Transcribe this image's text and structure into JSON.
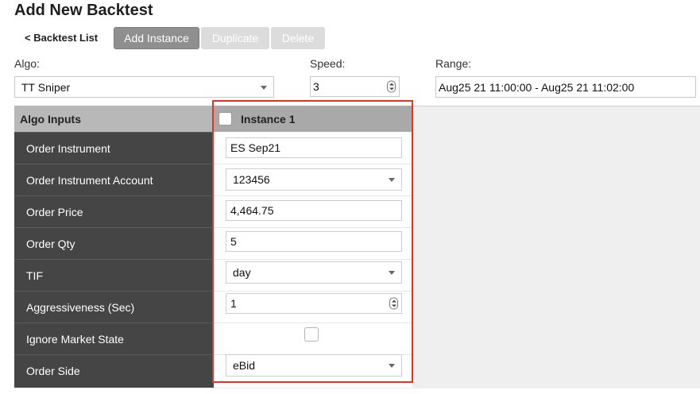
{
  "page": {
    "title": "Add New Backtest"
  },
  "toolbar": {
    "back_label": "< Backtest List",
    "add_instance_label": "Add Instance",
    "duplicate_label": "Duplicate",
    "delete_label": "Delete"
  },
  "settings": {
    "algo_label": "Algo:",
    "algo_value": "TT Sniper",
    "speed_label": "Speed:",
    "speed_value": "3",
    "range_label": "Range:",
    "range_value": "Aug25 21 11:00:00 - Aug25 21 11:02:00"
  },
  "grid": {
    "header_left": "Algo Inputs",
    "instance_label": "Instance 1",
    "instance_checked": false,
    "rows": [
      {
        "label": "Order Instrument",
        "value": "ES Sep21",
        "kind": "text"
      },
      {
        "label": "Order Instrument Account",
        "value": "123456",
        "kind": "select"
      },
      {
        "label": "Order Price",
        "value": "4,464.75",
        "kind": "text"
      },
      {
        "label": "Order Qty",
        "value": "5",
        "kind": "text"
      },
      {
        "label": "TIF",
        "value": "day",
        "kind": "select"
      },
      {
        "label": "Aggressiveness (Sec)",
        "value": "1",
        "kind": "spinner"
      },
      {
        "label": "Ignore Market State",
        "value": "",
        "kind": "checkbox",
        "checked": false
      },
      {
        "label": "Order Side",
        "value": "eBid",
        "kind": "select"
      }
    ]
  },
  "colors": {
    "highlight": "#e8321f",
    "label_column": "#454545",
    "header": "#b8b8b8",
    "primary_button": "#8f8f8f",
    "disabled_button": "#dcdcdc"
  }
}
